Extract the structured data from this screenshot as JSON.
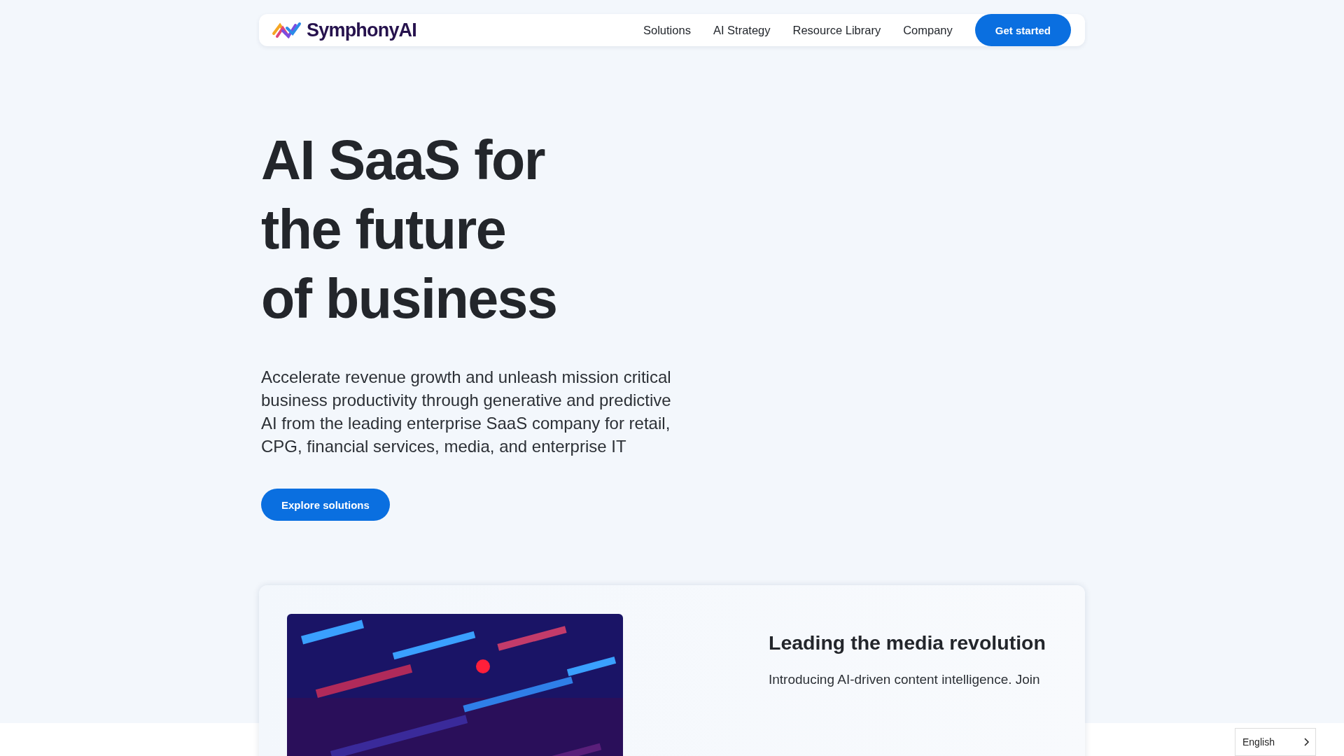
{
  "header": {
    "logo": "SymphonyAI",
    "nav": [
      {
        "label": "Solutions"
      },
      {
        "label": "AI Strategy"
      },
      {
        "label": "Resource Library"
      },
      {
        "label": "Company"
      }
    ],
    "cta": "Get started"
  },
  "hero": {
    "title_lines": [
      "AI SaaS for",
      "the future",
      "of business"
    ],
    "text": "Accelerate revenue growth and unleash mission critical business productivity through generative and predictive AI from the leading enterprise SaaS company for retail, CPG, financial services, media, and enterprise IT",
    "button": "Explore solutions"
  },
  "feature_card": {
    "title": "Leading the media revolution",
    "text": "Introducing AI-driven content intelligence. Join"
  },
  "language_selector": {
    "value": "English"
  }
}
